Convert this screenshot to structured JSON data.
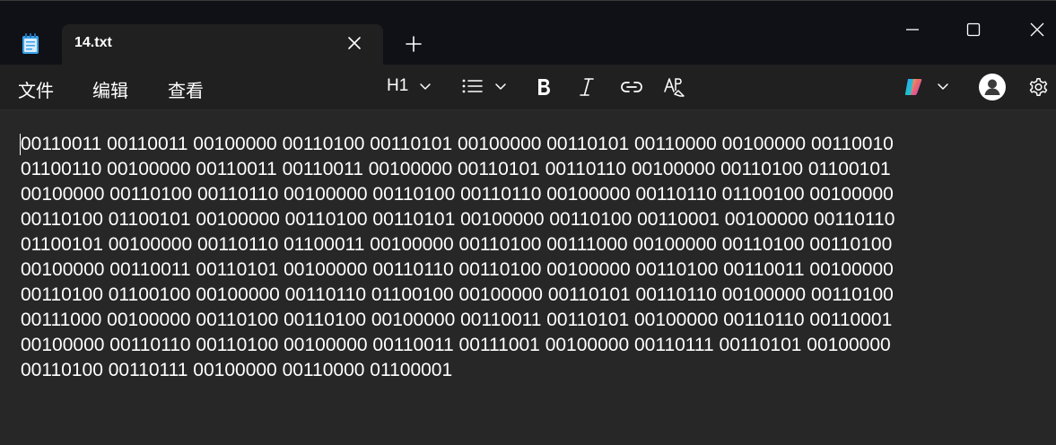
{
  "window": {
    "tab_title": "14.txt"
  },
  "menu": {
    "file": "文件",
    "edit": "编辑",
    "view": "查看"
  },
  "toolbar": {
    "heading": "H1"
  },
  "colors": {
    "titlebar_bg": "#0f1117",
    "editor_bg": "#272727",
    "toolbar_bg": "#202020",
    "notepad_icon_blue": "#3aa0e8"
  },
  "icons": {
    "app": "notepad-icon",
    "close_tab": "close-icon",
    "new_tab": "plus-icon",
    "minimize": "minimize-icon",
    "maximize": "maximize-icon",
    "close_window": "close-icon",
    "heading_dropdown": "chevron-down-icon",
    "list": "list-icon",
    "bold": "bold-icon",
    "italic": "italic-icon",
    "link": "link-icon",
    "clear_format": "clear-formatting-icon",
    "copilot": "copilot-icon",
    "account": "account-icon",
    "settings": "gear-icon"
  },
  "document": {
    "lines": [
      "00110011 00110011 00100000 00110100 00110101 00100000 00110101 00110000 00100000 00110010",
      "01100110 00100000 00110011 00110011 00100000 00110101 00110110 00100000 00110100 01100101",
      "00100000 00110100 00110110 00100000 00110100 00110110 00100000 00110110 01100100 00100000",
      "00110100 01100101 00100000 00110100 00110101 00100000 00110100 00110001 00100000 00110110",
      "01100101 00100000 00110110 01100011 00100000 00110100 00111000 00100000 00110100 00110100",
      "00100000 00110011 00110101 00100000 00110110 00110100 00100000 00110100 00110011 00100000",
      "00110100 01100100 00100000 00110110 01100100 00100000 00110101 00110110 00100000 00110100",
      "00111000 00100000 00110100 00110100 00100000 00110011 00110101 00100000 00110110 00110001",
      "00100000 00110110 00110100 00100000 00110011 00111001 00100000 00110111 00110101 00100000",
      "00110100 00110111 00100000 00110000 01100001"
    ]
  }
}
